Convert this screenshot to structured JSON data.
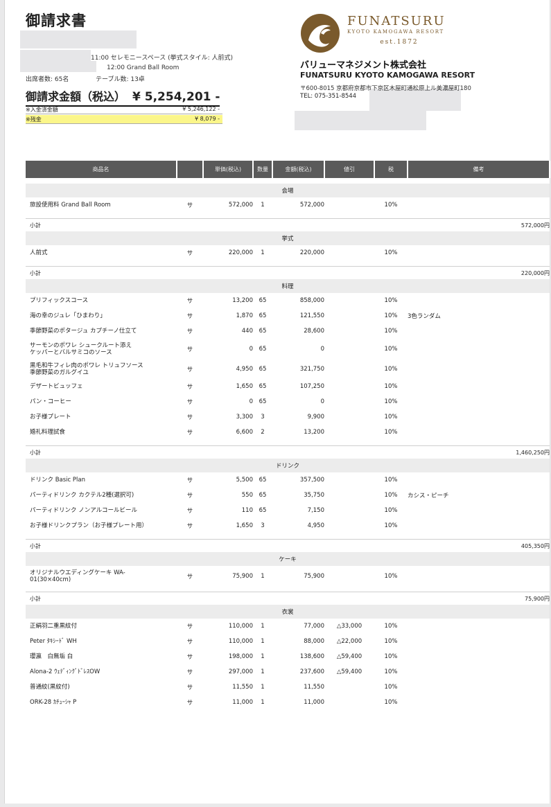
{
  "header": {
    "title": "御請求書",
    "line1": "11:00 セレモニースペース (挙式スタイル: 人前式)",
    "line2": "12:00 Grand Ball Room",
    "guests": "出席者数: 65名",
    "tables": "テーブル数: 13卓",
    "total_label": "御請求金額（税込）",
    "total_amount": "¥ 5,254,201 -",
    "paid_label": "※入金済金額",
    "paid_amount": "¥ 5,246,122 -",
    "balance_label": "※残金",
    "balance_amount": "¥ 8,079 -"
  },
  "company": {
    "brand": "FUNATSURU",
    "brand_sub": "KYOTO KAMOGAWA RESORT",
    "est": "est.1872",
    "name": "バリューマネジメント株式会社",
    "resort": "FUNATSURU KYOTO KAMOGAWA RESORT",
    "address": "〒600-8015 京都府京都市下京区木屋町通松原上ル美濃屋町180",
    "tel": "TEL: 075-351-8544",
    "logo_color": "#7a5a2c"
  },
  "table": {
    "headers": [
      "商品名",
      "単価(税込)",
      "数量",
      "金額(税込)",
      "値引",
      "税",
      "備考"
    ],
    "subtotal_label": "小計",
    "tax_mark": "サ",
    "sections": [
      {
        "name": "会場",
        "subtotal": "572,000円",
        "items": [
          {
            "name": "旅設使用料 Grand Ball Room",
            "price": "572,000",
            "qty": "1",
            "amount": "572,000",
            "discount": "",
            "tax": "10%",
            "note": ""
          }
        ]
      },
      {
        "name": "挙式",
        "subtotal": "220,000円",
        "items": [
          {
            "name": "人前式",
            "price": "220,000",
            "qty": "1",
            "amount": "220,000",
            "discount": "",
            "tax": "10%",
            "note": ""
          }
        ]
      },
      {
        "name": "料理",
        "subtotal": "1,460,250円",
        "items": [
          {
            "name": "プリフィックスコース",
            "price": "13,200",
            "qty": "65",
            "amount": "858,000",
            "discount": "",
            "tax": "10%",
            "note": ""
          },
          {
            "name": "海の幸のジュレ「ひまわり」",
            "price": "1,870",
            "qty": "65",
            "amount": "121,550",
            "discount": "",
            "tax": "10%",
            "note": "3色ランダム"
          },
          {
            "name": "季節野菜のポタージュ カプチーノ仕立て",
            "price": "440",
            "qty": "65",
            "amount": "28,600",
            "discount": "",
            "tax": "10%",
            "note": ""
          },
          {
            "name": "サーモンのポワレ シュークルート添え\nケッパーとバルサミコのソース",
            "price": "0",
            "qty": "65",
            "amount": "0",
            "discount": "",
            "tax": "10%",
            "note": ""
          },
          {
            "name": "黒毛和牛フィレ肉のポワレ トリュフソース\n季節野菜のガルグイユ",
            "price": "4,950",
            "qty": "65",
            "amount": "321,750",
            "discount": "",
            "tax": "10%",
            "note": ""
          },
          {
            "name": "デザートビュッフェ",
            "price": "1,650",
            "qty": "65",
            "amount": "107,250",
            "discount": "",
            "tax": "10%",
            "note": ""
          },
          {
            "name": "パン・コーヒー",
            "price": "0",
            "qty": "65",
            "amount": "0",
            "discount": "",
            "tax": "10%",
            "note": ""
          },
          {
            "name": "お子様プレート",
            "price": "3,300",
            "qty": "3",
            "amount": "9,900",
            "discount": "",
            "tax": "10%",
            "note": ""
          },
          {
            "name": "婚礼料理試食",
            "price": "6,600",
            "qty": "2",
            "amount": "13,200",
            "discount": "",
            "tax": "10%",
            "note": ""
          }
        ]
      },
      {
        "name": "ドリンク",
        "subtotal": "405,350円",
        "items": [
          {
            "name": "ドリンク Basic Plan",
            "price": "5,500",
            "qty": "65",
            "amount": "357,500",
            "discount": "",
            "tax": "10%",
            "note": ""
          },
          {
            "name": "パーティドリンク カクテル2種(選択可)",
            "price": "550",
            "qty": "65",
            "amount": "35,750",
            "discount": "",
            "tax": "10%",
            "note": "カシス・ピーチ"
          },
          {
            "name": "パーティドリンク ノンアルコールビール",
            "price": "110",
            "qty": "65",
            "amount": "7,150",
            "discount": "",
            "tax": "10%",
            "note": ""
          },
          {
            "name": "お子様ドリンクプラン（お子様プレート用）",
            "price": "1,650",
            "qty": "3",
            "amount": "4,950",
            "discount": "",
            "tax": "10%",
            "note": ""
          }
        ]
      },
      {
        "name": "ケーキ",
        "subtotal": "75,900円",
        "items": [
          {
            "name": "オリジナルウエディングケーキ WA-\n01(30×40cm)",
            "price": "75,900",
            "qty": "1",
            "amount": "75,900",
            "discount": "",
            "tax": "10%",
            "note": ""
          }
        ]
      },
      {
        "name": "衣裳",
        "subtotal": "",
        "items": [
          {
            "name": "正絹羽二重黒紋付",
            "price": "110,000",
            "qty": "1",
            "amount": "77,000",
            "discount": "△33,000",
            "tax": "10%",
            "note": ""
          },
          {
            "name": "Peter ﾀｷｼｰﾄﾞ WH",
            "price": "110,000",
            "qty": "1",
            "amount": "88,000",
            "discount": "△22,000",
            "tax": "10%",
            "note": ""
          },
          {
            "name": "瓔瀛　白無垢 白",
            "price": "198,000",
            "qty": "1",
            "amount": "138,600",
            "discount": "△59,400",
            "tax": "10%",
            "note": ""
          },
          {
            "name": "Alona-2 ｳｪﾃﾞｨﾝｸﾞﾄﾞﾚｽOW",
            "price": "297,000",
            "qty": "1",
            "amount": "237,600",
            "discount": "△59,400",
            "tax": "10%",
            "note": ""
          },
          {
            "name": "普通紋(黒紋付)",
            "price": "11,550",
            "qty": "1",
            "amount": "11,550",
            "discount": "",
            "tax": "10%",
            "note": ""
          },
          {
            "name": "ORK-28 ｶﾁｭｰｼｬ P",
            "price": "11,000",
            "qty": "1",
            "amount": "11,000",
            "discount": "",
            "tax": "10%",
            "note": ""
          }
        ]
      }
    ]
  }
}
